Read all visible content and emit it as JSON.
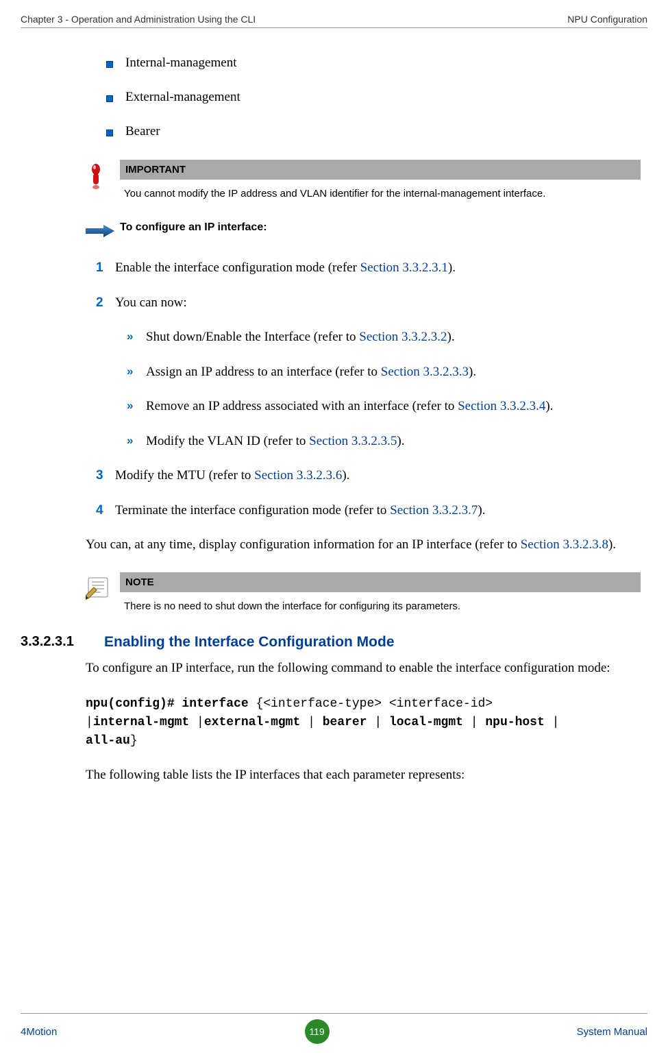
{
  "header": {
    "left": "Chapter 3 - Operation and Administration Using the CLI",
    "right": "NPU Configuration"
  },
  "bullets": {
    "b1": "Internal-management",
    "b2": "External-management",
    "b3": "Bearer"
  },
  "important": {
    "label": "IMPORTANT",
    "text": "You cannot modify the IP address and VLAN identifier for the internal-management interface."
  },
  "instruct": "To configure an IP interface:",
  "steps": {
    "s1": {
      "num": "1",
      "t1": "Enable the interface configuration mode (refer ",
      "link": "Section 3.3.2.3.1",
      "t2": ")."
    },
    "s2": {
      "num": "2",
      "text": "You can now:"
    },
    "sub1": {
      "t1": "Shut down/Enable the Interface (refer to ",
      "link": "Section 3.3.2.3.2",
      "t2": ")."
    },
    "sub2": {
      "t1": "Assign an IP address to an interface (refer to ",
      "link": "Section 3.3.2.3.3",
      "t2": ")."
    },
    "sub3": {
      "t1": "Remove an IP address associated with an interface (refer to ",
      "link": "Section 3.3.2.3.4",
      "t2": ")."
    },
    "sub4": {
      "t1": "Modify the VLAN ID (refer to ",
      "link": "Section 3.3.2.3.5",
      "t2": ")."
    },
    "s3": {
      "num": "3",
      "t1": "Modify the MTU (refer to ",
      "link": "Section 3.3.2.3.6",
      "t2": ")."
    },
    "s4": {
      "num": "4",
      "t1": "Terminate the interface configuration mode (refer to ",
      "link": "Section 3.3.2.3.7",
      "t2": ")."
    }
  },
  "para1": {
    "t1": "You can, at any time, display configuration information for an IP interface (refer to ",
    "link": "Section 3.3.2.3.8",
    "t2": ")."
  },
  "note": {
    "label": "NOTE",
    "text": "There is no need to shut down the interface for configuring its parameters."
  },
  "section": {
    "num": "3.3.2.3.1",
    "title": "Enabling the Interface Configuration Mode"
  },
  "para2": "To configure an IP interface, run the following command to enable the interface configuration mode:",
  "code": {
    "l1a": "npu(config)# interface ",
    "l1b": "{<interface-type> <interface-id> ",
    "l2a": "|",
    "l2b": "internal-mgmt ",
    "l2c": "|",
    "l2d": "external-mgmt ",
    "l2e": "| ",
    "l2f": "bearer ",
    "l2g": "| ",
    "l2h": "local-mgmt ",
    "l2i": "| ",
    "l2j": "npu-host ",
    "l2k": "| ",
    "l3a": "all-au",
    "l3b": "}"
  },
  "para3": "The following table lists the IP interfaces that each parameter represents:",
  "footer": {
    "left": "4Motion",
    "page": "119",
    "right": "System Manual"
  }
}
